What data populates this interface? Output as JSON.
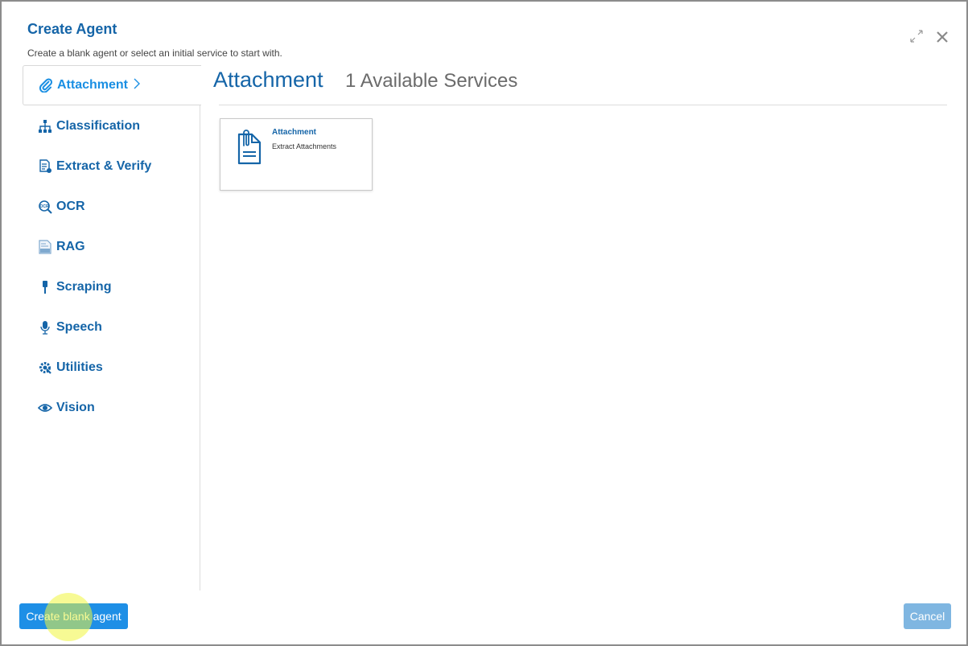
{
  "dialog": {
    "title": "Create Agent",
    "subtitle": "Create a blank agent or select an initial service to start with."
  },
  "sidebar": {
    "items": [
      {
        "label": "Attachment",
        "icon": "paperclip-icon",
        "active": true
      },
      {
        "label": "Classification",
        "icon": "hierarchy-icon"
      },
      {
        "label": "Extract & Verify",
        "icon": "document-check-icon"
      },
      {
        "label": "OCR",
        "icon": "ocr-search-icon"
      },
      {
        "label": "RAG",
        "icon": "rag-document-icon"
      },
      {
        "label": "Scraping",
        "icon": "brush-icon"
      },
      {
        "label": "Speech",
        "icon": "microphone-icon"
      },
      {
        "label": "Utilities",
        "icon": "gear-wrench-icon"
      },
      {
        "label": "Vision",
        "icon": "eye-icon"
      }
    ]
  },
  "main": {
    "title": "Attachment",
    "count_label": "1 Available Services",
    "cards": [
      {
        "title": "Attachment",
        "description": "Extract Attachments",
        "icon": "attachment-document-icon"
      }
    ]
  },
  "footer": {
    "create_label": "Create blank agent",
    "cancel_label": "Cancel"
  },
  "colors": {
    "accent": "#1565a8",
    "active": "#1a8fe3",
    "primary_button": "#1e8fe6",
    "cancel_button": "#7fb6e1"
  }
}
